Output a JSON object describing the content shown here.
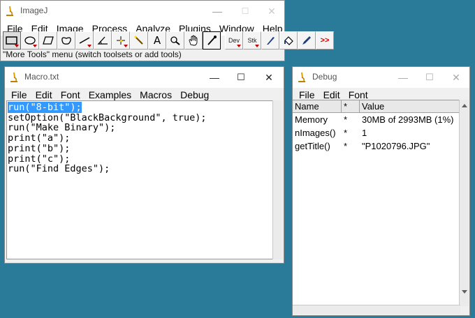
{
  "imagej": {
    "title": "ImageJ",
    "menu": [
      "File",
      "Edit",
      "Image",
      "Process",
      "Analyze",
      "Plugins",
      "Window",
      "Help"
    ],
    "tools": [
      {
        "icon": "rectangle-tool-icon"
      },
      {
        "icon": "oval-tool-icon"
      },
      {
        "icon": "polygon-tool-icon"
      },
      {
        "icon": "freehand-tool-icon"
      },
      {
        "icon": "line-tool-icon"
      },
      {
        "icon": "angle-tool-icon"
      },
      {
        "icon": "point-tool-icon"
      },
      {
        "icon": "wand-tool-icon"
      },
      {
        "icon": "text-tool-icon",
        "glyph": "A"
      },
      {
        "icon": "magnifier-tool-icon"
      },
      {
        "icon": "hand-tool-icon"
      },
      {
        "icon": "color-picker-tool-icon"
      },
      {
        "icon": "developer-menu-icon",
        "label": "Dev"
      },
      {
        "icon": "stacks-menu-icon",
        "label": "Stk"
      },
      {
        "icon": "brush-tool-icon"
      },
      {
        "icon": "flood-fill-tool-icon"
      },
      {
        "icon": "pencil-tool-icon"
      },
      {
        "icon": "more-tools-icon",
        "label": ">>"
      }
    ],
    "status": "\"More Tools\" menu (switch toolsets or add tools)"
  },
  "macro": {
    "title": "Macro.txt",
    "menu": [
      "File",
      "Edit",
      "Font",
      "Examples",
      "Macros",
      "Debug"
    ],
    "lines": [
      "run(\"8-bit\");",
      "setOption(\"BlackBackground\", true);",
      "run(\"Make Binary\");",
      "print(\"a\");",
      "print(\"b\");",
      "print(\"c\");",
      "run(\"Find Edges\");"
    ]
  },
  "debug": {
    "title": "Debug",
    "menu": [
      "File",
      "Edit",
      "Font"
    ],
    "columns": [
      "Name",
      "*",
      "Value"
    ],
    "rows": [
      [
        "Memory",
        "*",
        "30MB of 2993MB (1%)"
      ],
      [
        "nImages()",
        "*",
        "1"
      ],
      [
        "getTitle()",
        "*",
        "\"P1020796.JPG\""
      ]
    ]
  },
  "window_controls": {
    "minimize": "—",
    "maximize": "☐",
    "close": "✕"
  },
  "colors": {
    "desktop": "#2a7a9a",
    "selection": "#3399ff",
    "more_tools_arrow": "#cc0000"
  }
}
